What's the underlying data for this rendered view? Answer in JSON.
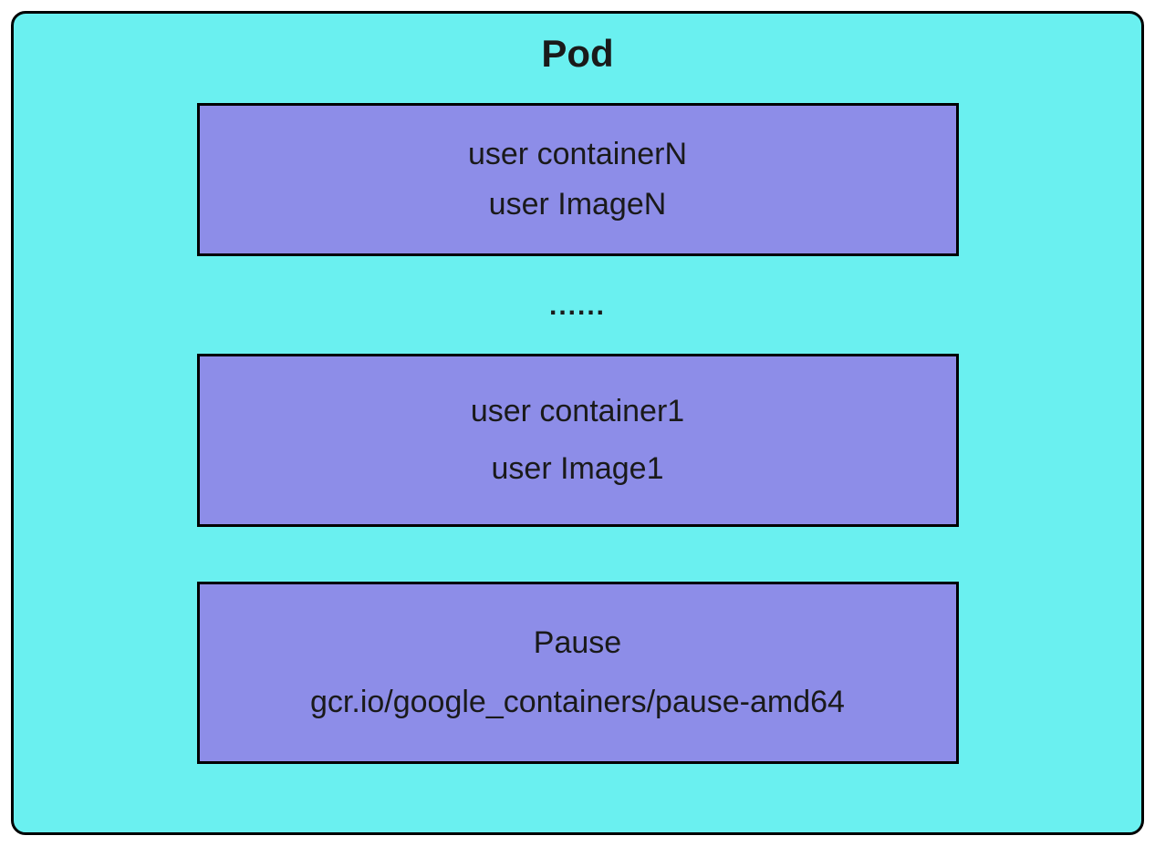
{
  "pod": {
    "title": "Pod",
    "ellipsis": "......",
    "boxes": {
      "n": {
        "container": "user containerN",
        "image": "user ImageN"
      },
      "one": {
        "container": "user container1",
        "image": "user Image1"
      },
      "pause": {
        "name": "Pause",
        "image": "gcr.io/google_containers/pause-amd64"
      }
    }
  }
}
